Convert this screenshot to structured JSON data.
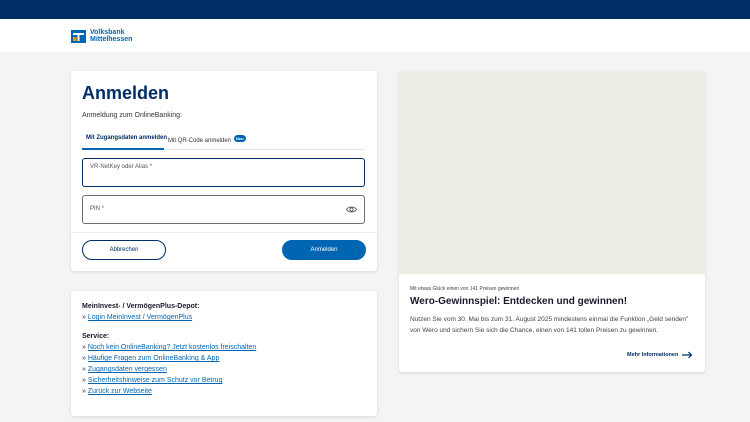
{
  "brand": {
    "name_line1": "Volksbank",
    "name_line2": "Mittelhessen",
    "colors": {
      "navy": "#002d67",
      "blue": "#0066b3",
      "orange": "#f39200"
    }
  },
  "login": {
    "title": "Anmelden",
    "subtitle": "Anmeldung zum OnlineBanking:",
    "tabs": [
      {
        "label": "Mit Zugangsdaten anmelden",
        "active": true
      },
      {
        "label": "Mit QR-Code anmelden",
        "badge": "Neu",
        "active": false
      }
    ],
    "username_label": "VR-NetKey oder Alias *",
    "pin_label": "PIN *",
    "pin_icon": "eye-icon",
    "cancel_label": "Abbrechen",
    "submit_label": "Anmelden"
  },
  "links": {
    "depot_title": "MeinInvest- / VermögenPlus-Depot:",
    "depot_links": [
      {
        "prefix": "» ",
        "label": "Login MeinInvest / VermögenPlus"
      }
    ],
    "service_title": "Service:",
    "service_links": [
      {
        "prefix": "» ",
        "label": "Noch kein OnlineBanking? Jetzt kostenlos freischalten"
      },
      {
        "prefix": "» ",
        "label": "Häufige Fragen zum OnlineBanking & App"
      },
      {
        "prefix": "» ",
        "label": "Zugangsdaten vergessen"
      },
      {
        "prefix": "» ",
        "label": "Sicherheitshinweise zum Schutz vor Betrug"
      },
      {
        "prefix": "» ",
        "label": "Zurück zur Webseite"
      }
    ]
  },
  "promo": {
    "kicker": "Mit etwas Glück einen von 141 Preisen gewinnen",
    "title": "Wero-Gewinnspiel: Entdecken und gewinnen!",
    "text": "Nutzen Sie vom 30. Mai bis zum 31. August 2025 mindestens einmal die Funktion „Geld senden\" von Wero und sichern Sie sich die Chance, einen von 141 tollen Preisen zu gewinnen.",
    "more_label": "Mehr Informationen",
    "more_icon": "arrow-right-icon"
  }
}
